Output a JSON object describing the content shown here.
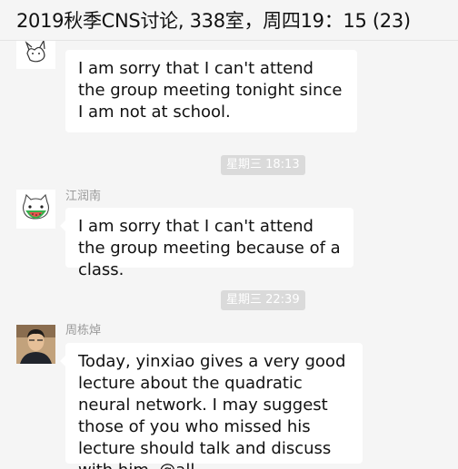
{
  "header": {
    "title": "2019秋季CNS讨论, 338室，周四19：15 (23)"
  },
  "messages": [
    {
      "text": "I am sorry that I can't attend the group meeting tonight since I am not at school."
    },
    {
      "sender": "江润南",
      "text": "I am sorry that I can't attend the group meeting because of a class."
    },
    {
      "sender": "周栋焯",
      "text": "Today, yinxiao gives a very good lecture about the quadratic neural network. I may suggest those of you who missed his lecture should talk and discuss with him. @all"
    }
  ],
  "timestamps": [
    "星期三 18:13",
    "星期三 22:39"
  ],
  "colors": {
    "bubble": "#ffffff",
    "background": "#f5f5f5",
    "timestamp_bg": "#dadada",
    "watermelon_red": "#e8554e",
    "watermelon_green": "#37b24d"
  },
  "icons": [
    "cat-avatar-icon",
    "cat-watermelon-avatar-icon",
    "person-avatar"
  ]
}
